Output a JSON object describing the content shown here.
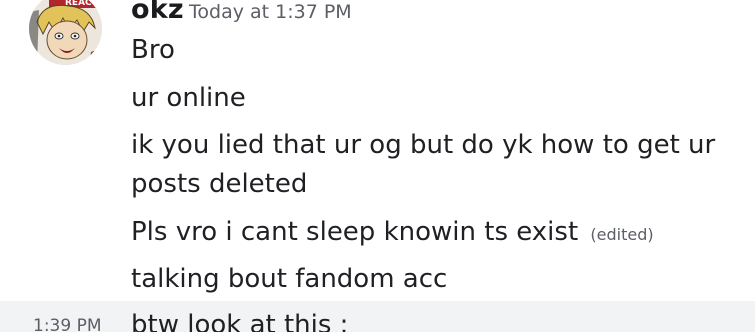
{
  "message_group": {
    "author": "okz",
    "timestamp": "Today at 1:37 PM",
    "avatar_badge_text": "REAC"
  },
  "messages": [
    {
      "text": "Bro"
    },
    {
      "text": "ur online"
    },
    {
      "text": "ik you lied that ur og but do yk how to get ur"
    },
    {
      "text": "posts deleted"
    },
    {
      "text": "Pls vro i cant sleep knowin ts exist",
      "edited_label": "(edited)"
    },
    {
      "text": "talking bout fandom acc"
    }
  ],
  "next_message": {
    "time": "1:39 PM",
    "text": "btw look at this :"
  }
}
